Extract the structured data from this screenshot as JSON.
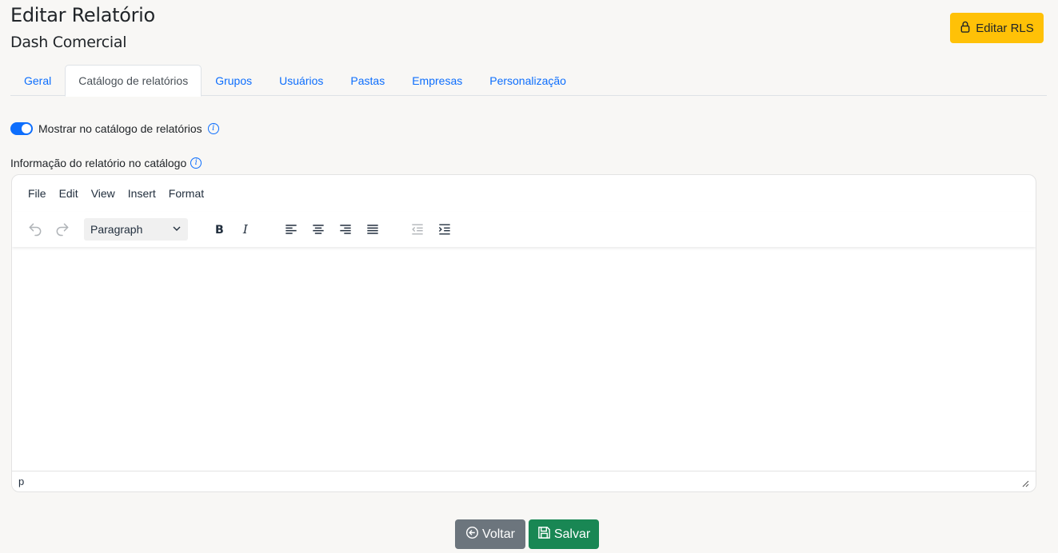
{
  "header": {
    "title": "Editar Relatório",
    "subtitle": "Dash Comercial",
    "rls_button_label": "Editar RLS"
  },
  "tabs": [
    {
      "label": "Geral",
      "active": false
    },
    {
      "label": "Catálogo de relatórios",
      "active": true
    },
    {
      "label": "Grupos",
      "active": false
    },
    {
      "label": "Usuários",
      "active": false
    },
    {
      "label": "Pastas",
      "active": false
    },
    {
      "label": "Empresas",
      "active": false
    },
    {
      "label": "Personalização",
      "active": false
    }
  ],
  "catalog": {
    "show_in_catalog_label": "Mostrar no catálogo de relatórios",
    "show_in_catalog": true,
    "info_label": "Informação do relatório no catálogo"
  },
  "editor": {
    "menu": [
      "File",
      "Edit",
      "View",
      "Insert",
      "Format"
    ],
    "block_format": "Paragraph",
    "content": "",
    "status_path": "p"
  },
  "actions": {
    "back_label": "Voltar",
    "save_label": "Salvar"
  },
  "colors": {
    "primary": "#0d6efd",
    "warning": "#ffc107",
    "secondary": "#6c757d",
    "success": "#198754",
    "background": "#f8f7f5"
  }
}
